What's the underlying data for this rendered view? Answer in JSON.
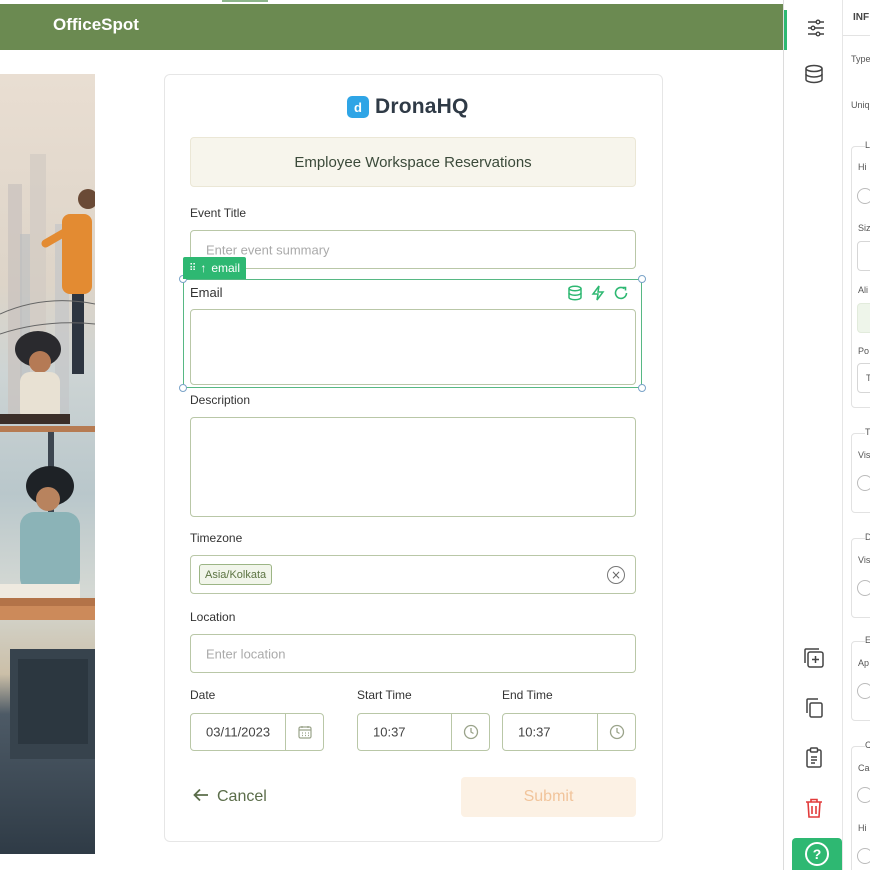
{
  "app": {
    "title": "OfficeSpot"
  },
  "form": {
    "brand": "DronaHQ",
    "brand_mark": "d",
    "banner": "Employee Workspace Reservations",
    "event_title": {
      "label": "Event Title",
      "placeholder": "Enter event summary"
    },
    "email": {
      "label": "Email",
      "tag": "email",
      "value": ""
    },
    "description": {
      "label": "Description",
      "value": ""
    },
    "timezone": {
      "label": "Timezone",
      "value": "Asia/Kolkata"
    },
    "location": {
      "label": "Location",
      "placeholder": "Enter location"
    },
    "date": {
      "label": "Date",
      "value": "03/11/2023"
    },
    "start_time": {
      "label": "Start Time",
      "value": "10:37"
    },
    "end_time": {
      "label": "End Time",
      "value": "10:37"
    },
    "cancel_label": "Cancel",
    "submit_label": "Submit"
  },
  "properties_panel": {
    "header": "INF",
    "rows": [
      "Type",
      "Uniq",
      "L",
      "Hi",
      "Siz",
      "Ali",
      "Po",
      "T",
      "T",
      "Vis",
      "D",
      "Vis",
      "E",
      "Ap",
      "C",
      "Ca",
      "Hi"
    ]
  },
  "colors": {
    "header": "#6b8a51",
    "accent": "#2eb872",
    "brand": "#2fa5e6",
    "submit_bg": "#fcf1e4",
    "submit_text": "#f1c49b",
    "delete": "#e23b3b"
  },
  "icons": {
    "rail": [
      "sliders-icon",
      "database-icon",
      "add-component-icon",
      "copy-icon",
      "paste-icon",
      "trash-icon",
      "help-icon"
    ],
    "email_tools": [
      "database-icon",
      "bolt-icon",
      "refresh-icon"
    ]
  }
}
